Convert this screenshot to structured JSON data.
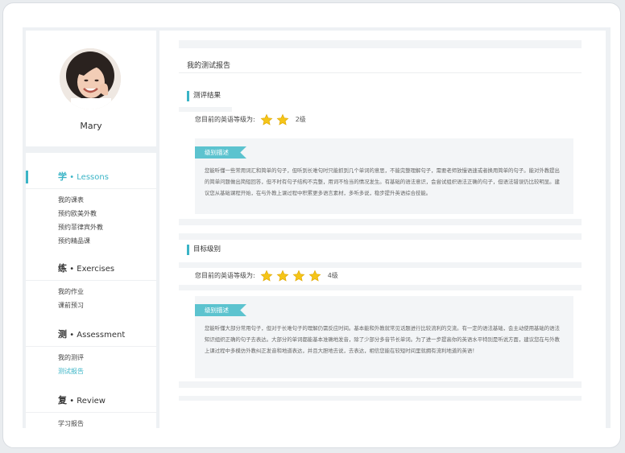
{
  "profile": {
    "name": "Mary"
  },
  "menu": {
    "sections": [
      {
        "hz": "学",
        "label": "• Lessons",
        "items": [
          "我的课表",
          "预约欧美外教",
          "预约菲律宾外教",
          "预约精品课"
        ]
      },
      {
        "hz": "练",
        "label": "• Exercises",
        "items": [
          "我的作业",
          "课前预习"
        ]
      },
      {
        "hz": "测",
        "label": "• Assessment",
        "items": [
          "我的测评",
          "测试报告"
        ]
      },
      {
        "hz": "复",
        "label": "• Review",
        "items": [
          "学习报告"
        ]
      }
    ],
    "active_section": "学 • Lessons",
    "active_item": "测试报告"
  },
  "report": {
    "page_title": "我的测试报告",
    "result": {
      "title": "测评结果",
      "level_label": "您目前的英语等级为:",
      "stars": 2,
      "grade": "2级",
      "tag": "级别描述",
      "description": "您能听懂一些常用词汇和简单的句子，但听到长难句时只能抓到几个单词的意思，不能完整理解句子，需要老师放慢语速或者换用简单的句子。能对外教提出的简单问题做出简短回答，但不时有句子结构不完整，用词不恰当的情况发生。有基础的语法意识，会尝试组织语法正确的句子，但语法错误仍比较明显。建议您从基础课程开始，在与外教上课过程中积累更多语言素材，多听多说，稳步提升英语综合技能。"
    },
    "target": {
      "title": "目标级别",
      "level_label": "您目前的英语等级为:",
      "stars": 4,
      "grade": "4级",
      "tag": "级别描述",
      "description": "您能听懂大部分常用句子，但对于长难句子的理解仍需反应时间。基本能和外教就常见话题进行比较流利的交流。有一定的语法基础，会主动使用基础的语法知识组织正确的句子去表达。大部分的单词都能基本准确地发音，除了少部分多音节长单词。为了进一步提高你的英语水平特別是听说方面，建议您在与外教上课过程中多模仿外教纠正发音和地道表达，并且大胆地去说，去表达，相信您能在较短时间里就拥有流利地道的英语！"
    }
  },
  "colors": {
    "accent": "#3ab4c6",
    "tag_bg": "#5cc3cf",
    "star": "#f5c518"
  }
}
